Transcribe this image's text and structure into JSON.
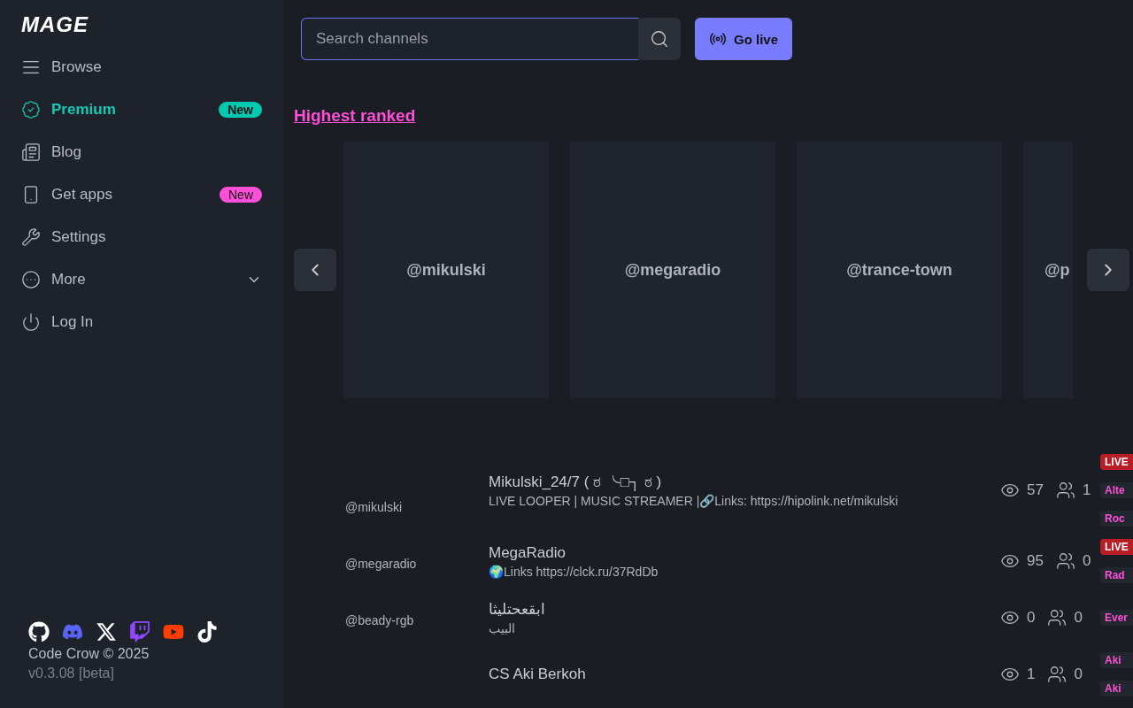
{
  "logo": "MAGE",
  "sidebar": {
    "items": [
      {
        "label": "Browse",
        "selected": false
      },
      {
        "label": "Premium",
        "selected": true,
        "badge": {
          "label": "New",
          "color": "#00c9b1"
        }
      },
      {
        "label": "Blog",
        "selected": false
      },
      {
        "label": "Get apps",
        "selected": false,
        "badge": {
          "label": "New",
          "color": "#ff4fd8"
        }
      },
      {
        "label": "Settings",
        "selected": false
      },
      {
        "label": "More",
        "selected": false,
        "expanded": false
      },
      {
        "label": "Log In",
        "selected": false
      }
    ],
    "copyright": "Code Crow © 2025",
    "version": "v0.3.08 [beta]"
  },
  "search": {
    "placeholder": "Search channels"
  },
  "go_live": "Go live",
  "section_title": "Highest ranked",
  "carousel": [
    "@mikulski",
    "@megaradio",
    "@trance-town",
    "@p"
  ],
  "channels": [
    {
      "handle": "@mikulski",
      "title": "Mikulski_24/7 ( ಠ ╰□┐ ಠ )",
      "description": "LIVE LOOPER | MUSIC STREAMER |🔗Links: https://hipolink.net/mikulski",
      "viewers": "57",
      "followers": "1",
      "tags": [
        {
          "label": "LIVE",
          "kind": "live"
        },
        {
          "label": "Alte",
          "kind": "category"
        },
        {
          "label": "Roc",
          "kind": "category"
        }
      ]
    },
    {
      "handle": "@megaradio",
      "title": "MegaRadio",
      "description": "🌍Links https://clck.ru/37RdDb",
      "viewers": "95",
      "followers": "0",
      "tags": [
        {
          "label": "LIVE",
          "kind": "live"
        },
        {
          "label": "Rad",
          "kind": "category"
        }
      ]
    },
    {
      "handle": "@beady-rgb",
      "title": "ابقعحتليثا",
      "description": "البيب",
      "viewers": "0",
      "followers": "0",
      "tags": [
        {
          "label": "Ever",
          "kind": "category"
        }
      ]
    },
    {
      "title": "CS Aki Berkoh",
      "viewers": "1",
      "followers": "0",
      "tags": [
        {
          "label": "Aki",
          "kind": "category"
        },
        {
          "label": "Aki",
          "kind": "category"
        }
      ]
    }
  ]
}
